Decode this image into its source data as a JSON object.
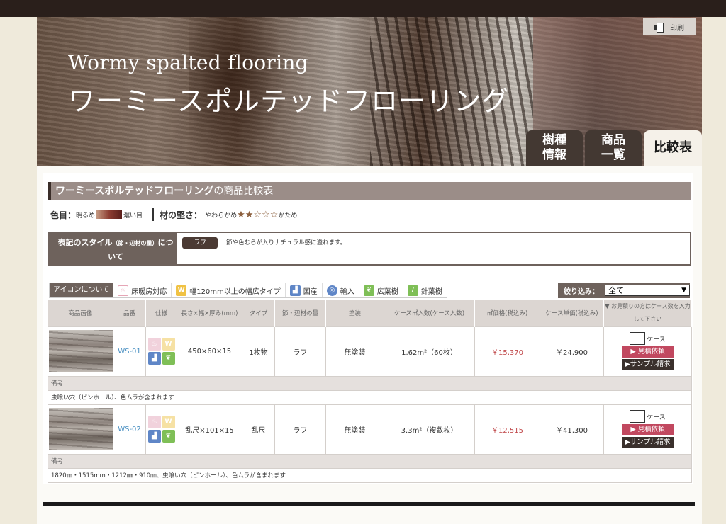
{
  "header": {
    "title_en": "Wormy spalted flooring",
    "title_ja": "ワーミースポルテッドフローリング",
    "print_label": "印刷",
    "tabs": [
      {
        "label": "樹種\n情報"
      },
      {
        "label": "商品\n一覧"
      },
      {
        "label": "比較表"
      }
    ]
  },
  "section": {
    "title_bold": "ワーミースポルテッドフローリング",
    "title_rest": "の商品比較表"
  },
  "legend": {
    "color_label": "色目：",
    "color_light": "明るめ",
    "color_dark": "濃い目",
    "hardness_label": "材の堅さ：",
    "hardness_soft": "やわらかめ",
    "stars": "★★☆☆☆",
    "hardness_hard": "かため"
  },
  "style": {
    "label_main": "表記のスタイル",
    "label_sub": "（節・辺材の量）",
    "label_end": "について",
    "chip": "ラフ",
    "description": "節や色むらが入りナチュラル感に溢れます。"
  },
  "icon_bar": {
    "about": "アイコンについて",
    "items": [
      {
        "label": "床暖房対応",
        "icon": "heating-icon"
      },
      {
        "label": "幅120mm以上の幅広タイプ",
        "icon": "wide-icon"
      },
      {
        "label": "国産",
        "icon": "domestic-icon"
      },
      {
        "label": "輸入",
        "icon": "import-icon"
      },
      {
        "label": "広葉樹",
        "icon": "broadleaf-icon"
      },
      {
        "label": "針葉樹",
        "icon": "conifer-icon"
      }
    ]
  },
  "filter": {
    "label": "絞り込み：",
    "value": "全て"
  },
  "table": {
    "headers": [
      "商品画像",
      "品番",
      "仕様",
      "長さ×幅×厚み(mm)",
      "タイプ",
      "節・辺材の量",
      "塗装",
      "ケース㎡入数(ケース入数)",
      "㎡価格(税込み)",
      "ケース単価(税込み)",
      "▼ お見積りの方はケース数を入力して下さい"
    ],
    "rows": [
      {
        "code": "WS-01",
        "size": "450×60×15",
        "type": "1枚物",
        "knots": "ラフ",
        "finish": "無塗装",
        "case_qty": "1.62m²（60枚）",
        "sqm_price": "￥15,370",
        "case_price": "￥24,900",
        "note_label": "備考",
        "note": "虫喰い穴（ピンホール）、色ムラが含まれます"
      },
      {
        "code": "WS-02",
        "size": "乱尺×101×15",
        "type": "乱尺",
        "knots": "ラフ",
        "finish": "無塗装",
        "case_qty": "3.3m²（複数枚）",
        "sqm_price": "￥12,515",
        "case_price": "￥41,300",
        "note_label": "備考",
        "note": "1820㎜・1515mm・1212㎜・910㎜、虫喰い穴（ピンホール）、色ムラが含まれます"
      }
    ],
    "case_unit": "ケース",
    "quote_label": "▶ 見積依頼",
    "sample_label": "▶サンプル請求"
  },
  "colors": {
    "brand_dark": "#2a1f1b",
    "header_bar": "#9b8d88",
    "quote_button": "#c1485f",
    "price_red": "#c0484a",
    "code_blue": "#4a90c2"
  }
}
